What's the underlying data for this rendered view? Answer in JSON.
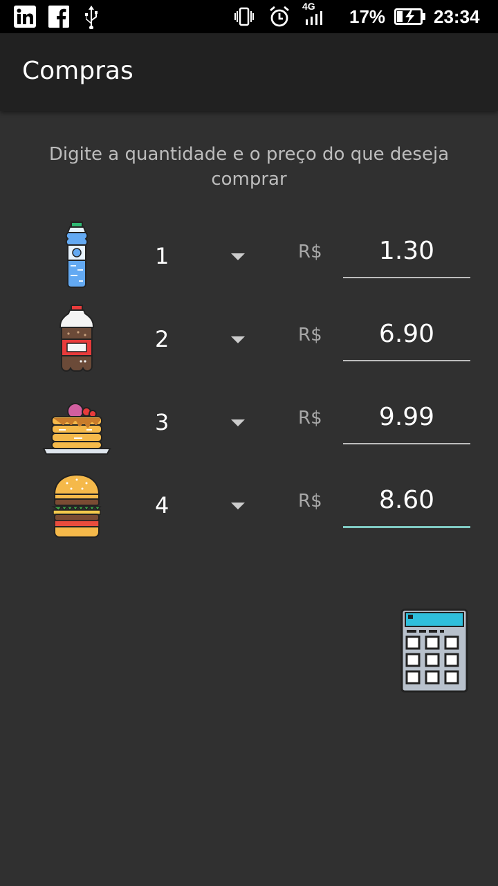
{
  "status_bar": {
    "battery": "17%",
    "time": "23:34",
    "network": "4G",
    "left_icons": [
      "linkedin-icon",
      "facebook-icon",
      "usb-icon"
    ],
    "right_icons": [
      "vibrate-icon",
      "alarm-icon",
      "signal-icon",
      "battery-charging-icon"
    ]
  },
  "app_bar": {
    "title": "Compras"
  },
  "instructions": "Digite a quantidade e o preço do que deseja comprar",
  "items": [
    {
      "icon": "water-bottle-icon",
      "quantity": "1",
      "currency": "R$",
      "price": "1.30"
    },
    {
      "icon": "soda-bottle-icon",
      "quantity": "2",
      "currency": "R$",
      "price": "6.90"
    },
    {
      "icon": "pancakes-icon",
      "quantity": "3",
      "currency": "R$",
      "price": "9.99"
    },
    {
      "icon": "burger-icon",
      "quantity": "4",
      "currency": "R$",
      "price": "8.60"
    }
  ],
  "calculate_button": {
    "icon": "calculator-icon"
  },
  "colors": {
    "background": "#303030",
    "app_bar": "#212121",
    "accent": "#80cbc4"
  }
}
